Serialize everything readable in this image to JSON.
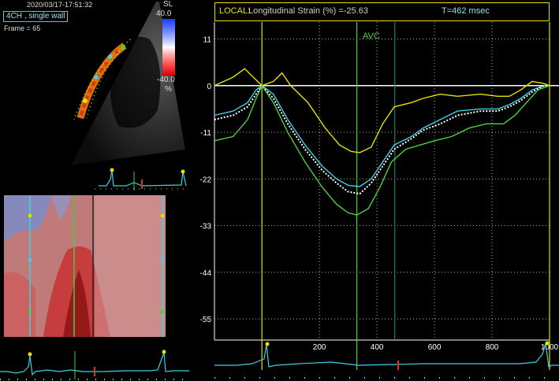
{
  "header": {
    "datetime": "2020/03/17-17:51:32",
    "view": "4CH , single wall",
    "frame": "Frame = 65"
  },
  "color_scale": {
    "name": "SL",
    "top": "40.0",
    "bottom": "-40.0",
    "unit": "%"
  },
  "strain_panel": {
    "local_label": "LOCAL:",
    "measure_label": "Longitudinal Strain (%) =-25.63",
    "time_label": "T=462 msec",
    "avc_label": "AVC"
  },
  "chart_data": {
    "type": "line",
    "title": "Longitudinal Strain (%)",
    "xlabel": "",
    "ylabel": "",
    "xlim": [
      -165,
      1000
    ],
    "ylim": [
      -60,
      15
    ],
    "x_ticks": [
      200,
      400,
      600,
      800,
      1000
    ],
    "y_ticks": [
      11,
      0,
      -11,
      -22,
      -33,
      -44,
      -55
    ],
    "markers": {
      "avc_ms": 330,
      "cursor_ms": 462,
      "start_ms": 0,
      "end_ms": 1000
    },
    "series": [
      {
        "color": "#e6e000",
        "points": [
          [
            -165,
            0
          ],
          [
            -100,
            2
          ],
          [
            -60,
            4
          ],
          [
            -30,
            2
          ],
          [
            0,
            0
          ],
          [
            40,
            1
          ],
          [
            70,
            3
          ],
          [
            100,
            0
          ],
          [
            160,
            -4
          ],
          [
            220,
            -10
          ],
          [
            270,
            -14
          ],
          [
            310,
            -15.5
          ],
          [
            340,
            -15.8
          ],
          [
            380,
            -14.5
          ],
          [
            420,
            -9
          ],
          [
            460,
            -5
          ],
          [
            520,
            -4
          ],
          [
            560,
            -3
          ],
          [
            620,
            -2
          ],
          [
            680,
            -2.5
          ],
          [
            760,
            -2
          ],
          [
            820,
            -2.5
          ],
          [
            860,
            -2.5
          ],
          [
            900,
            -1
          ],
          [
            940,
            1
          ],
          [
            980,
            0.5
          ],
          [
            1000,
            0
          ]
        ]
      },
      {
        "color": "#3fd0e0",
        "points": [
          [
            -165,
            -7
          ],
          [
            -100,
            -6
          ],
          [
            -50,
            -4
          ],
          [
            -20,
            -1
          ],
          [
            0,
            0
          ],
          [
            40,
            -2
          ],
          [
            90,
            -8
          ],
          [
            150,
            -14
          ],
          [
            210,
            -19
          ],
          [
            260,
            -22
          ],
          [
            300,
            -23.5
          ],
          [
            340,
            -23.8
          ],
          [
            380,
            -22
          ],
          [
            420,
            -18
          ],
          [
            460,
            -14
          ],
          [
            520,
            -12
          ],
          [
            560,
            -10
          ],
          [
            620,
            -8
          ],
          [
            680,
            -6
          ],
          [
            760,
            -5.5
          ],
          [
            820,
            -5.5
          ],
          [
            860,
            -4.5
          ],
          [
            900,
            -3
          ],
          [
            940,
            -1
          ],
          [
            980,
            0
          ],
          [
            1000,
            0
          ]
        ]
      },
      {
        "color": "#ffffff",
        "dashed": true,
        "points": [
          [
            -165,
            -8
          ],
          [
            -100,
            -7
          ],
          [
            -50,
            -5
          ],
          [
            -20,
            -2
          ],
          [
            0,
            0
          ],
          [
            40,
            -3
          ],
          [
            90,
            -9
          ],
          [
            150,
            -15
          ],
          [
            210,
            -20
          ],
          [
            260,
            -23
          ],
          [
            300,
            -25
          ],
          [
            340,
            -25.5
          ],
          [
            380,
            -23
          ],
          [
            420,
            -19
          ],
          [
            460,
            -15
          ],
          [
            520,
            -12.5
          ],
          [
            560,
            -10.5
          ],
          [
            620,
            -9
          ],
          [
            680,
            -7
          ],
          [
            760,
            -6
          ],
          [
            820,
            -6
          ],
          [
            860,
            -5
          ],
          [
            900,
            -3.5
          ],
          [
            940,
            -1.5
          ],
          [
            980,
            0
          ],
          [
            1000,
            0
          ]
        ]
      },
      {
        "color": "#4fd040",
        "points": [
          [
            -165,
            -13
          ],
          [
            -100,
            -12
          ],
          [
            -50,
            -8
          ],
          [
            -20,
            -3
          ],
          [
            0,
            0
          ],
          [
            40,
            -4
          ],
          [
            90,
            -11
          ],
          [
            150,
            -18
          ],
          [
            210,
            -24
          ],
          [
            260,
            -28
          ],
          [
            300,
            -30
          ],
          [
            330,
            -30.5
          ],
          [
            370,
            -29
          ],
          [
            410,
            -24
          ],
          [
            450,
            -18
          ],
          [
            500,
            -15
          ],
          [
            550,
            -14
          ],
          [
            600,
            -13
          ],
          [
            660,
            -12
          ],
          [
            720,
            -10
          ],
          [
            780,
            -9
          ],
          [
            840,
            -9
          ],
          [
            880,
            -7
          ],
          [
            920,
            -4
          ],
          [
            960,
            -1
          ],
          [
            1000,
            0
          ]
        ]
      }
    ]
  }
}
